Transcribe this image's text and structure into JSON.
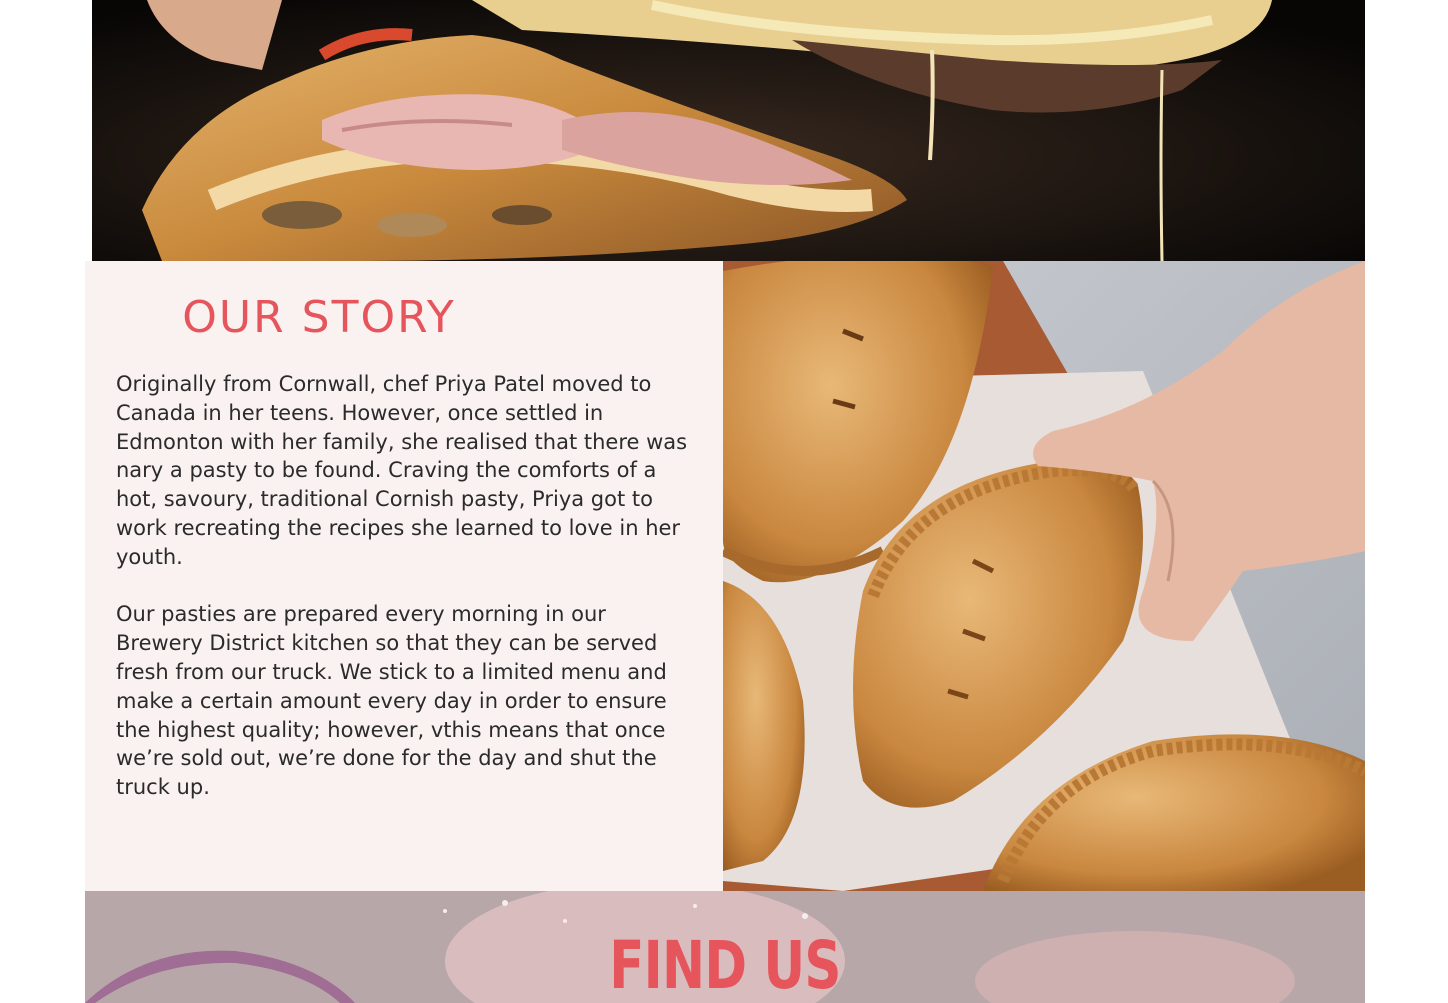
{
  "hero": {
    "image": "calzone-cheese-pull-photo"
  },
  "story": {
    "title": "OUR STORY",
    "paragraphs": [
      "Originally from Cornwall, chef Priya Patel moved to Canada in her teens. However, once settled in Edmonton with her family, she realised that there was nary a pasty to be found. Craving the comforts of a hot, savoury, traditional Cornish pasty, Priya got to work recreating the recipes she learned to love in her youth.",
      "Our pasties are prepared every morning in our Brewery District kitchen so that they can be served fresh from our truck. We stick to a limited menu and make a certain amount every day in order to ensure the highest quality; however, vthis means that once we’re sold out, we’re done for the day and shut the truck up."
    ],
    "image": "pasties-on-board-photo"
  },
  "find_us": {
    "title": "FIND US",
    "image": "flour-dough-hands-photo"
  },
  "colors": {
    "accent": "#e6555b",
    "story_bg": "#f9f2f1",
    "body_text": "#2b2b2b"
  }
}
